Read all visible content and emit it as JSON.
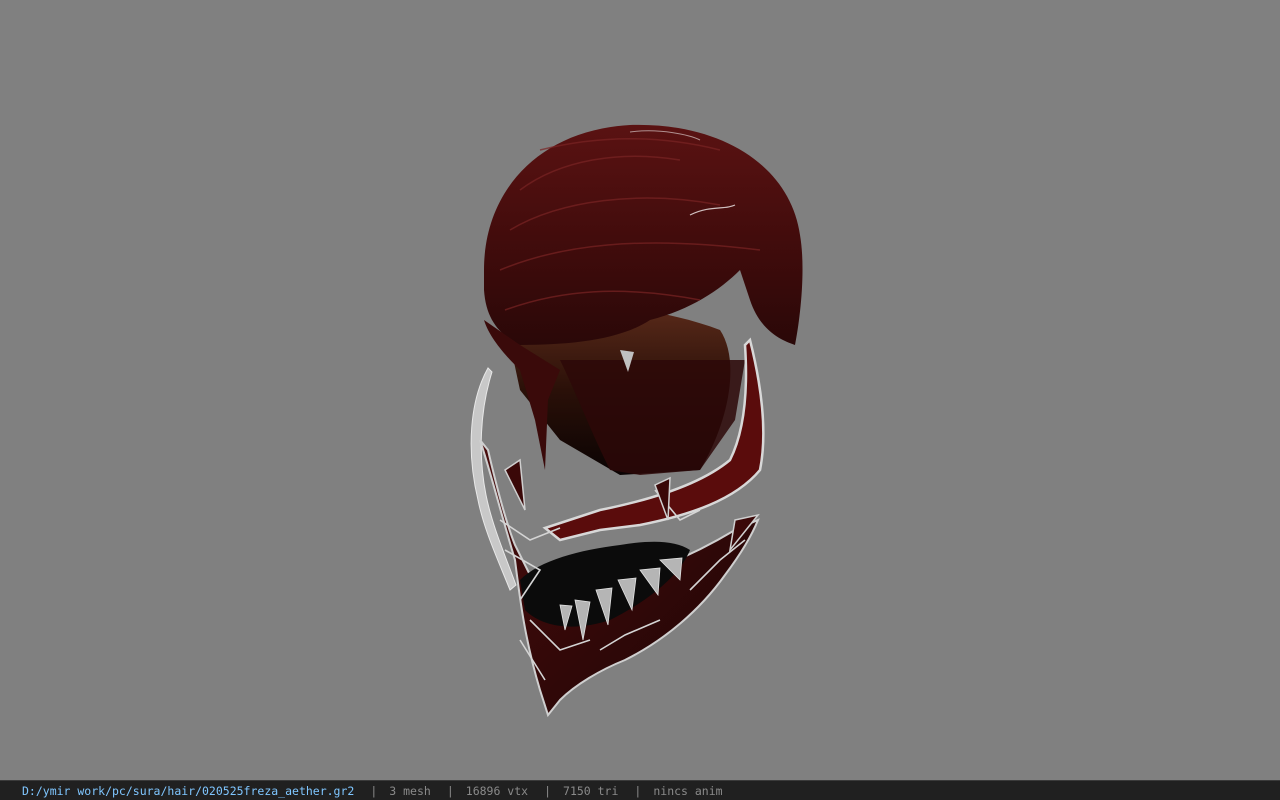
{
  "viewer": {
    "background_color": "#808080",
    "model_icon": "hair-helmet-model-icon"
  },
  "status_bar": {
    "file_path": "D:/ymir work/pc/sura/hair/020525freza_aether.gr2",
    "separator": "|",
    "mesh_count": "3 mesh",
    "vertex_count": "16896 vtx",
    "triangle_count": "7150 tri",
    "anim_status": "nincs anim",
    "path_color": "#7fc6ff",
    "text_color": "#8a8a8a"
  }
}
